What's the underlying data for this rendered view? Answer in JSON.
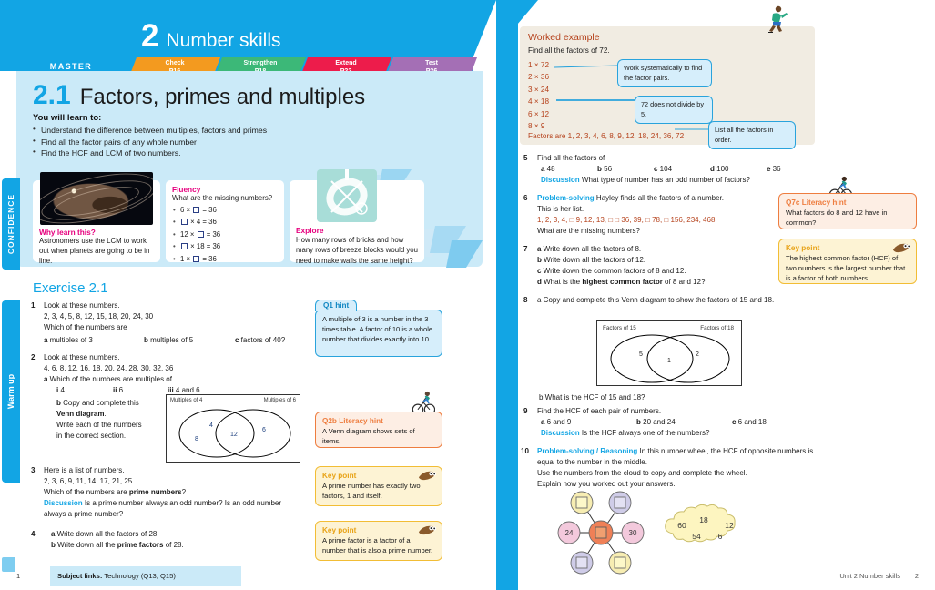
{
  "book": {
    "unit_number": "2",
    "unit_title": "Number skills",
    "master_label": "MASTER",
    "nav_tabs": [
      {
        "label": "Check",
        "page": "P16",
        "color": "#f39a1f"
      },
      {
        "label": "Strengthen",
        "page": "P18",
        "color": "#3cb878"
      },
      {
        "label": "Extend",
        "page": "P22",
        "color": "#ed1c4b"
      },
      {
        "label": "Test",
        "page": "P26",
        "color": "#a46fb5"
      }
    ],
    "lesson_number": "2.1",
    "lesson_title": "Factors, primes and multiples",
    "footer_left_page": "1",
    "footer_right_text": "Unit 2 Number skills",
    "footer_right_page": "2",
    "subject_links_label": "Subject links:",
    "subject_links_text": "Technology (Q13, Q15)"
  },
  "side_tabs": {
    "confidence": "CONFIDENCE",
    "warm_up": "Warm up"
  },
  "objectives": {
    "heading": "You will learn to:",
    "items": [
      "Understand the difference between multiples, factors and primes",
      "Find all the factor pairs of any whole number",
      "Find the HCF and LCM of two numbers."
    ]
  },
  "why_learn": {
    "title": "Why learn this?",
    "text": "Astronomers use the LCM to work out when planets are going to be in line."
  },
  "fluency": {
    "title": "Fluency",
    "question": "What are the missing numbers?",
    "items": [
      {
        "pre": "6 × ",
        "post": " = 36"
      },
      {
        "pre": "",
        "post": " × 4 = 36"
      },
      {
        "pre": "12 × ",
        "post": " = 36"
      },
      {
        "pre": "",
        "post": " × 18 = 36"
      },
      {
        "pre": "1 × ",
        "post": " = 36"
      }
    ]
  },
  "explore": {
    "title": "Explore",
    "text": "How many rows of bricks and how many rows of breeze blocks would you need to make walls the same height?"
  },
  "exercise": {
    "title": "Exercise 2.1",
    "questions": [
      {
        "number": "1",
        "lines": [
          "Look at these numbers.",
          "2, 3, 4, 5, 8, 12, 15, 18, 20, 24, 30",
          "Which of the numbers are"
        ],
        "parts": [
          "a multiples of 3",
          "b multiples of 5",
          "c factors of 40?"
        ]
      },
      {
        "number": "2",
        "lines": [
          "Look at these numbers.",
          "4, 6, 8, 12, 16, 18, 20, 24, 28, 30, 32, 36",
          "a Which of the numbers are multiples of"
        ],
        "parts": [
          "i 4",
          "ii 6",
          "iii 4 and 6."
        ],
        "part_b": [
          "b Copy and complete this",
          "Venn diagram.",
          "Write each of the numbers",
          "in the correct section."
        ]
      },
      {
        "number": "3",
        "lines": [
          "Here is a list of numbers.",
          "2, 3, 6, 9, 11, 14, 17, 21, 25",
          "Which of the numbers are prime numbers?"
        ],
        "discussion_label": "Discussion",
        "discussion": "Is a prime number always an odd number? Is an odd number always a prime number?"
      },
      {
        "number": "4",
        "parts_stacked": [
          "a Write down all the factors of 28.",
          "b Write down all the prime factors of 28."
        ]
      }
    ]
  },
  "venn_left": {
    "label_left": "Multiples of 4",
    "label_right": "Multiples of 6",
    "left_values": [
      "4",
      "8"
    ],
    "middle_value": "12",
    "right_value": "6"
  },
  "hints_left": [
    {
      "id": "q1-hint",
      "style": "blue",
      "title": "Q1 hint",
      "body": "A multiple of 3 is a number in the 3 times table. A factor of 10 is a whole number that divides exactly into 10."
    },
    {
      "id": "q2b-literacy-hint",
      "style": "orange",
      "title": "Q2b Literacy hint",
      "body": "A Venn diagram shows sets of items."
    },
    {
      "id": "key-point-prime-number",
      "style": "yellow",
      "title": "Key point",
      "body": "A prime number has exactly two factors, 1 and itself."
    },
    {
      "id": "key-point-prime-factor",
      "style": "yellow",
      "title": "Key point",
      "body": "A prime factor is a factor of a number that is also a prime number."
    }
  ],
  "worked_example": {
    "title": "Worked example",
    "subtitle": "Find all the factors of 72.",
    "pairs": [
      "1 × 72",
      "2 × 36",
      "3 × 24",
      "4 × 18",
      "6 × 12",
      "8 × 9"
    ],
    "answer": "Factors are 1, 2, 3, 4, 6, 8, 9, 12, 18, 24, 36, 72",
    "callouts": [
      "Work systematically to find the factor pairs.",
      "72 does not divide by 5.",
      "List all the factors in order."
    ]
  },
  "right_questions": [
    {
      "number": "5",
      "lines": [
        "Find all the factors of"
      ],
      "parts": [
        "a 48",
        "b 56",
        "c 104",
        "d 100",
        "e 36"
      ],
      "discussion_label": "Discussion",
      "discussion": "What type of number has an odd number of factors?"
    },
    {
      "number": "6",
      "tag": "Problem-solving",
      "lines": [
        "Hayley finds all the factors of a number.",
        "This is her list.",
        "What are the missing numbers?"
      ],
      "list_text": "1, 2, 3, 4, □ 9, 12, 13, □ □ 36, 39, □ 78, □ 156, 234, 468"
    },
    {
      "number": "7",
      "parts_stacked": [
        "a Write down all the factors of 8.",
        "b Write down all the factors of 12.",
        "c Write down the common factors of 8 and 12.",
        "d What is the highest common factor of 8 and 12?"
      ]
    },
    {
      "number": "8",
      "lines": [
        "a Copy and complete this Venn diagram to show the factors of 15 and 18."
      ],
      "after": "b What is the HCF of 15 and 18?"
    },
    {
      "number": "9",
      "lines": [
        "Find the HCF of each pair of numbers."
      ],
      "parts": [
        "a 6 and 9",
        "b 20 and 24",
        "c 6 and 18"
      ],
      "discussion_label": "Discussion",
      "discussion": "Is the HCF always one of the numbers?"
    },
    {
      "number": "10",
      "tag": "Problem-solving / Reasoning",
      "lines": [
        "In this number wheel, the HCF of opposite numbers is equal to the number in the middle.",
        "Use the numbers from the cloud to copy and complete the wheel.",
        "Explain how you worked out your answers."
      ]
    }
  ],
  "venn_right": {
    "label_left": "Factors of 15",
    "label_right": "Factors of 18",
    "left_value": "5",
    "middle_value": "1",
    "right_value": "2"
  },
  "number_wheel": {
    "left_value": "24",
    "right_value": "30",
    "centre_value": "",
    "blank_nodes": 4,
    "cloud_numbers": [
      "60",
      "18",
      "12",
      "54",
      "6"
    ]
  },
  "hints_right": [
    {
      "id": "q7c-literacy-hint",
      "style": "orange",
      "title": "Q7c Literacy hint",
      "body": "What factors do 8 and 12 have in common?"
    },
    {
      "id": "key-point-hcf",
      "style": "yellow",
      "title": "Key point",
      "body": "The highest common factor (HCF) of two numbers is the largest number that is a factor of both numbers."
    }
  ],
  "colors": {
    "brand_blue": "#12a5e4",
    "light_blue": "#cbeaf8",
    "pink_heading": "#e6007e",
    "orange_accent": "#ee7d3f",
    "yellow_accent": "#f2bd35",
    "worked_example_bg": "#f1ece2",
    "worked_example_text": "#b5411b"
  }
}
